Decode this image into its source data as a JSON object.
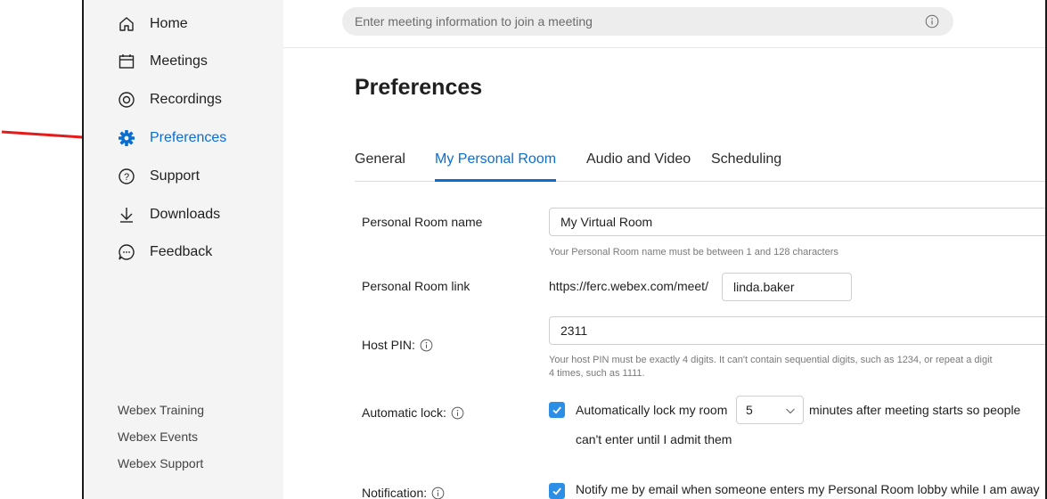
{
  "search": {
    "placeholder": "Enter meeting information to join a meeting"
  },
  "sidebar": {
    "items": [
      {
        "label": "Home",
        "icon": "home-icon"
      },
      {
        "label": "Meetings",
        "icon": "calendar-icon"
      },
      {
        "label": "Recordings",
        "icon": "recording-icon"
      },
      {
        "label": "Preferences",
        "icon": "gear-icon",
        "active": true
      },
      {
        "label": "Support",
        "icon": "help-icon"
      },
      {
        "label": "Downloads",
        "icon": "download-icon"
      },
      {
        "label": "Feedback",
        "icon": "feedback-icon"
      }
    ],
    "footer_links": [
      "Webex Training",
      "Webex Events",
      "Webex Support"
    ]
  },
  "page": {
    "title": "Preferences"
  },
  "tabs": [
    {
      "label": "General"
    },
    {
      "label": "My Personal Room",
      "active": true
    },
    {
      "label": "Audio and Video"
    },
    {
      "label": "Scheduling"
    }
  ],
  "form": {
    "room_name": {
      "label": "Personal Room name",
      "value": "My Virtual Room",
      "hint": "Your Personal Room name must be between 1 and 128 characters"
    },
    "room_link": {
      "label": "Personal Room link",
      "prefix": "https://ferc.webex.com/meet/",
      "value": "linda.baker"
    },
    "host_pin": {
      "label": "Host PIN:",
      "value": "2311",
      "hint_line1": "Your host PIN must be exactly 4 digits. It can't contain sequential digits, such as 1234, or repeat a digit",
      "hint_line2": "4 times, such as 1111."
    },
    "auto_lock": {
      "label": "Automatic lock:",
      "checked": true,
      "text_before": "Automatically lock my room",
      "minutes": "5",
      "text_after": "minutes after meeting starts so people",
      "text_line2": "can't enter until I admit them"
    },
    "notification": {
      "label": "Notification:",
      "checked": true,
      "text": "Notify me by email when someone enters my Personal Room lobby while I am away"
    }
  },
  "colors": {
    "accent": "#0a6ed1",
    "checkbox": "#2d8ee6",
    "arrow": "#e31b1b",
    "sidebar_bg": "#f4f4f4"
  }
}
